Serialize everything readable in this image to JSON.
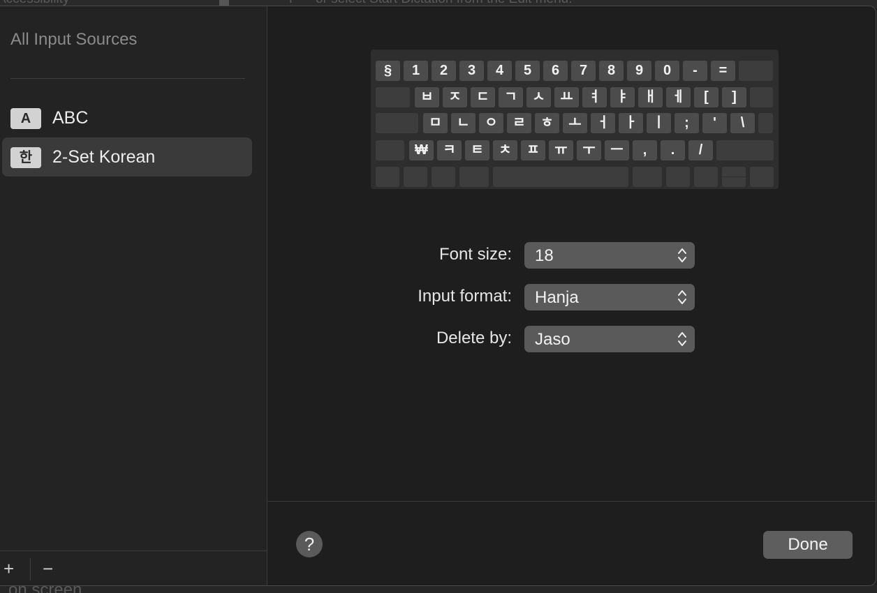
{
  "background": {
    "top_left_text": "Accessibility",
    "top_right_text": "or select Start Dictation from the Edit menu.",
    "top_plus": "+",
    "bottom_left_text": "on screen"
  },
  "sidebar": {
    "title": "All Input Sources",
    "items": [
      {
        "icon": "A",
        "label": "ABC",
        "selected": false
      },
      {
        "icon": "한",
        "label": "2-Set Korean",
        "selected": true
      }
    ],
    "add_label": "+",
    "remove_label": "−"
  },
  "keyboard": {
    "rows": [
      [
        "§",
        "1",
        "2",
        "3",
        "4",
        "5",
        "6",
        "7",
        "8",
        "9",
        "0",
        "-",
        "=",
        ""
      ],
      [
        "",
        "ㅂ",
        "ㅈ",
        "ㄷ",
        "ㄱ",
        "ㅅ",
        "ㅛ",
        "ㅕ",
        "ㅑ",
        "ㅐ",
        "ㅔ",
        "[",
        "]",
        ""
      ],
      [
        "",
        "ㅁ",
        "ㄴ",
        "ㅇ",
        "ㄹ",
        "ㅎ",
        "ㅗ",
        "ㅓ",
        "ㅏ",
        "ㅣ",
        ";",
        "'",
        "\\",
        ""
      ],
      [
        "",
        "₩",
        "ㅋ",
        "ㅌ",
        "ㅊ",
        "ㅍ",
        "ㅠ",
        "ㅜ",
        "ㅡ",
        ",",
        ".",
        "/",
        ""
      ],
      [
        "",
        "",
        "",
        "",
        "",
        "",
        "",
        "",
        "",
        ""
      ]
    ]
  },
  "settings": {
    "font_size": {
      "label": "Font size:",
      "value": "18"
    },
    "input_format": {
      "label": "Input format:",
      "value": "Hanja"
    },
    "delete_by": {
      "label": "Delete by:",
      "value": "Jaso"
    }
  },
  "footer": {
    "help_label": "?",
    "done_label": "Done"
  },
  "colors": {
    "sheet_bg": "#1e1e1e",
    "sidebar_bg": "#232323",
    "selected_bg": "#3a3a3a",
    "key_bg": "#4c4c4c",
    "button_bg": "#5e5e5e"
  }
}
